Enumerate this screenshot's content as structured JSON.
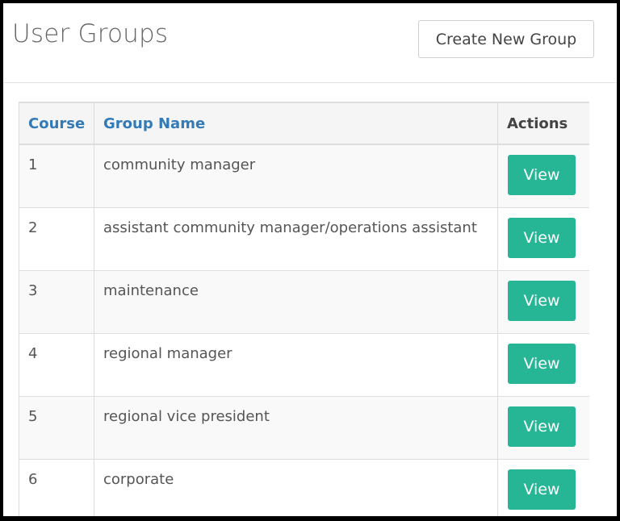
{
  "header": {
    "title": "User Groups",
    "create_label": "Create New Group"
  },
  "table": {
    "columns": [
      {
        "label": "Course"
      },
      {
        "label": "Group Name"
      },
      {
        "label": "Actions"
      }
    ],
    "rows": [
      {
        "course": "1",
        "name": "community manager",
        "action": "View"
      },
      {
        "course": "2",
        "name": "assistant community manager/operations assistant",
        "action": "View"
      },
      {
        "course": "3",
        "name": "maintenance",
        "action": "View"
      },
      {
        "course": "4",
        "name": "regional manager",
        "action": "View"
      },
      {
        "course": "5",
        "name": "regional vice president",
        "action": "View"
      },
      {
        "course": "6",
        "name": "corporate",
        "action": "View"
      }
    ]
  },
  "colors": {
    "link": "#337ab7",
    "view_button": "#26b595"
  }
}
